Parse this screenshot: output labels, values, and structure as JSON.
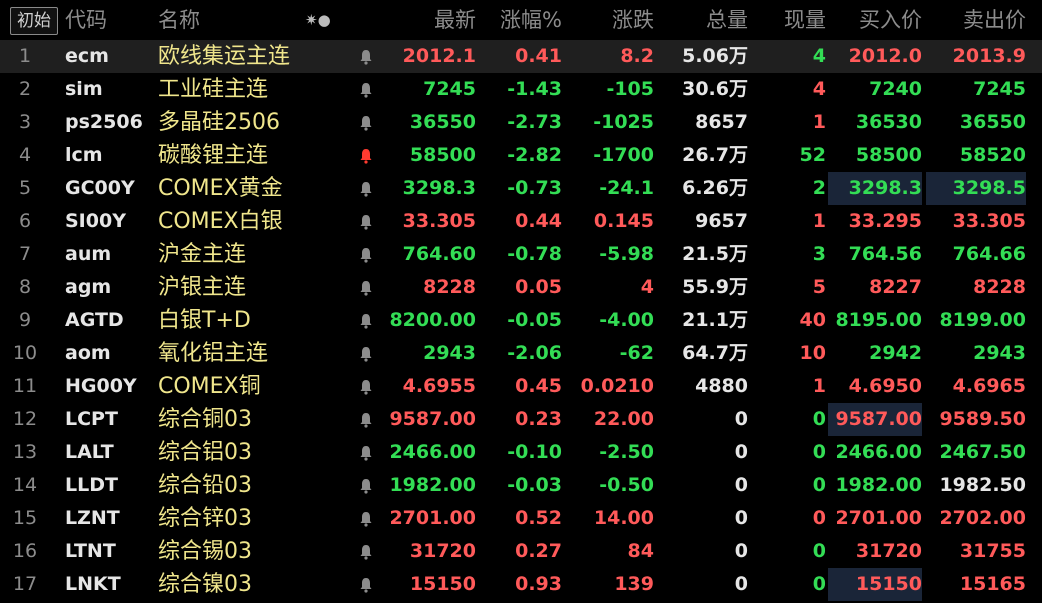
{
  "header": {
    "init_button": "初始",
    "code": "代码",
    "name": "名称",
    "icons": "✷●",
    "last": "最新",
    "pct": "涨幅%",
    "chg": "涨跌",
    "vol": "总量",
    "cur": "现量",
    "bid": "买入价",
    "ask": "卖出价"
  },
  "colors": {
    "up": "#ff5a5a",
    "down": "#33dd55",
    "name": "#f0e68c",
    "bell_active": "#ff3b30",
    "bell_idle": "#8c8c8c"
  },
  "rows": [
    {
      "idx": "1",
      "code": "ecm",
      "name": "欧线集运主连",
      "bell": "idle",
      "last": "2012.1",
      "pct": "0.41",
      "chg": "8.2",
      "vol": "5.06万",
      "cur": "4",
      "bid": "2012.0",
      "ask": "2013.9",
      "dir": "up",
      "cur_dir": "down",
      "bid_dir": "up",
      "ask_dir": "up",
      "selected": true
    },
    {
      "idx": "2",
      "code": "sim",
      "name": "工业硅主连",
      "bell": "idle",
      "last": "7245",
      "pct": "-1.43",
      "chg": "-105",
      "vol": "30.6万",
      "cur": "4",
      "bid": "7240",
      "ask": "7245",
      "dir": "down",
      "cur_dir": "up",
      "bid_dir": "down",
      "ask_dir": "down"
    },
    {
      "idx": "3",
      "code": "ps2506",
      "name": "多晶硅2506",
      "bell": "idle",
      "last": "36550",
      "pct": "-2.73",
      "chg": "-1025",
      "vol": "8657",
      "cur": "1",
      "bid": "36530",
      "ask": "36550",
      "dir": "down",
      "cur_dir": "up",
      "bid_dir": "down",
      "ask_dir": "down"
    },
    {
      "idx": "4",
      "code": "lcm",
      "name": "碳酸锂主连",
      "bell": "active",
      "last": "58500",
      "pct": "-2.82",
      "chg": "-1700",
      "vol": "26.7万",
      "cur": "52",
      "bid": "58500",
      "ask": "58520",
      "dir": "down",
      "cur_dir": "down",
      "bid_dir": "down",
      "ask_dir": "down"
    },
    {
      "idx": "5",
      "code": "GC00Y",
      "name": "COMEX黄金",
      "bell": "idle",
      "last": "3298.3",
      "pct": "-0.73",
      "chg": "-24.1",
      "vol": "6.26万",
      "cur": "2",
      "bid": "3298.3",
      "ask": "3298.5",
      "dir": "down",
      "cur_dir": "down",
      "bid_dir": "down",
      "ask_dir": "down",
      "bid_hl": true,
      "ask_hl": true
    },
    {
      "idx": "6",
      "code": "SI00Y",
      "name": "COMEX白银",
      "bell": "idle",
      "last": "33.305",
      "pct": "0.44",
      "chg": "0.145",
      "vol": "9657",
      "cur": "1",
      "bid": "33.295",
      "ask": "33.305",
      "dir": "up",
      "cur_dir": "up",
      "bid_dir": "up",
      "ask_dir": "up"
    },
    {
      "idx": "7",
      "code": "aum",
      "name": "沪金主连",
      "bell": "idle",
      "last": "764.60",
      "pct": "-0.78",
      "chg": "-5.98",
      "vol": "21.5万",
      "cur": "3",
      "bid": "764.56",
      "ask": "764.66",
      "dir": "down",
      "cur_dir": "down",
      "bid_dir": "down",
      "ask_dir": "down"
    },
    {
      "idx": "8",
      "code": "agm",
      "name": "沪银主连",
      "bell": "idle",
      "last": "8228",
      "pct": "0.05",
      "chg": "4",
      "vol": "55.9万",
      "cur": "5",
      "bid": "8227",
      "ask": "8228",
      "dir": "up",
      "cur_dir": "up",
      "bid_dir": "up",
      "ask_dir": "up"
    },
    {
      "idx": "9",
      "code": "AGTD",
      "name": "白银T+D",
      "bell": "idle",
      "last": "8200.00",
      "pct": "-0.05",
      "chg": "-4.00",
      "vol": "21.1万",
      "cur": "40",
      "bid": "8195.00",
      "ask": "8199.00",
      "dir": "down",
      "cur_dir": "up",
      "bid_dir": "down",
      "ask_dir": "down"
    },
    {
      "idx": "10",
      "code": "aom",
      "name": "氧化铝主连",
      "bell": "idle",
      "last": "2943",
      "pct": "-2.06",
      "chg": "-62",
      "vol": "64.7万",
      "cur": "10",
      "bid": "2942",
      "ask": "2943",
      "dir": "down",
      "cur_dir": "up",
      "bid_dir": "down",
      "ask_dir": "down"
    },
    {
      "idx": "11",
      "code": "HG00Y",
      "name": "COMEX铜",
      "bell": "idle",
      "last": "4.6955",
      "pct": "0.45",
      "chg": "0.0210",
      "vol": "4880",
      "cur": "1",
      "bid": "4.6950",
      "ask": "4.6965",
      "dir": "up",
      "cur_dir": "up",
      "bid_dir": "up",
      "ask_dir": "up"
    },
    {
      "idx": "12",
      "code": "LCPT",
      "name": "综合铜03",
      "bell": "idle",
      "last": "9587.00",
      "pct": "0.23",
      "chg": "22.00",
      "vol": "0",
      "cur": "0",
      "bid": "9587.00",
      "ask": "9589.50",
      "dir": "up",
      "cur_dir": "down",
      "bid_dir": "up",
      "ask_dir": "up",
      "bid_hl": true
    },
    {
      "idx": "13",
      "code": "LALT",
      "name": "综合铝03",
      "bell": "idle",
      "last": "2466.00",
      "pct": "-0.10",
      "chg": "-2.50",
      "vol": "0",
      "cur": "0",
      "bid": "2466.00",
      "ask": "2467.50",
      "dir": "down",
      "cur_dir": "down",
      "bid_dir": "down",
      "ask_dir": "down"
    },
    {
      "idx": "14",
      "code": "LLDT",
      "name": "综合铅03",
      "bell": "idle",
      "last": "1982.00",
      "pct": "-0.03",
      "chg": "-0.50",
      "vol": "0",
      "cur": "0",
      "bid": "1982.00",
      "ask": "1982.50",
      "dir": "down",
      "cur_dir": "down",
      "bid_dir": "down",
      "ask_dir": "flat"
    },
    {
      "idx": "15",
      "code": "LZNT",
      "name": "综合锌03",
      "bell": "idle",
      "last": "2701.00",
      "pct": "0.52",
      "chg": "14.00",
      "vol": "0",
      "cur": "0",
      "bid": "2701.00",
      "ask": "2702.00",
      "dir": "up",
      "cur_dir": "up",
      "bid_dir": "up",
      "ask_dir": "up"
    },
    {
      "idx": "16",
      "code": "LTNT",
      "name": "综合锡03",
      "bell": "idle",
      "last": "31720",
      "pct": "0.27",
      "chg": "84",
      "vol": "0",
      "cur": "0",
      "bid": "31720",
      "ask": "31755",
      "dir": "up",
      "cur_dir": "down",
      "bid_dir": "up",
      "ask_dir": "up"
    },
    {
      "idx": "17",
      "code": "LNKT",
      "name": "综合镍03",
      "bell": "idle",
      "last": "15150",
      "pct": "0.93",
      "chg": "139",
      "vol": "0",
      "cur": "0",
      "bid": "15150",
      "ask": "15165",
      "dir": "up",
      "cur_dir": "down",
      "bid_dir": "up",
      "ask_dir": "up",
      "bid_hl": true
    }
  ]
}
